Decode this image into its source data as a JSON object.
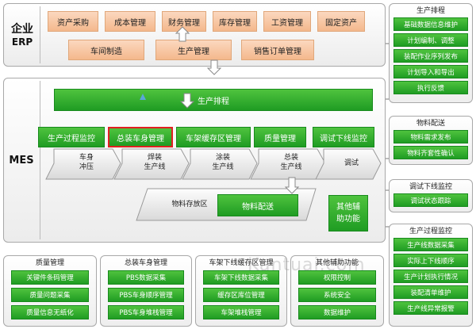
{
  "erp": {
    "label_top": "企业",
    "label_bottom": "ERP",
    "row1": [
      "资产采购",
      "成本管理",
      "财务管理",
      "库存管理",
      "工资管理",
      "固定资产"
    ],
    "row2": [
      "车间制造",
      "生产管理",
      "销售订单管理"
    ]
  },
  "mes": {
    "label": "MES",
    "top_bar": "生产排程",
    "modules": [
      "生产过程监控",
      "总装车身管理",
      "车架缓存区管理",
      "质量管理",
      "调试下线监控"
    ],
    "steps": [
      {
        "line1": "车身",
        "line2": "冲压"
      },
      {
        "line1": "焊装",
        "line2": "生产线"
      },
      {
        "line1": "涂装",
        "line2": "生产线"
      },
      {
        "line1": "总装",
        "line2": "生产线"
      },
      {
        "line1": "调试",
        "line2": ""
      }
    ],
    "storage_label": "物料存放区",
    "material_button": "物料配送",
    "other_line1": "其他辅",
    "other_line2": "助功能"
  },
  "right": [
    {
      "title": "生产排程",
      "items": [
        "基础数据信息维护",
        "计划编制、调整",
        "装配作业序列发布",
        "计划导入和导出",
        "执行反馈"
      ]
    },
    {
      "title": "物料配送",
      "items": [
        "物料需求发布",
        "物料齐套性确认"
      ]
    },
    {
      "title": "调试下线监控",
      "items": [
        "调试状态跟踪"
      ]
    },
    {
      "title": "生产过程监控",
      "items": [
        "生产线数据采集",
        "实际上下线顺序",
        "生产计划执行情况",
        "装配清单维护",
        "生产线异常报警"
      ]
    }
  ],
  "bottom": [
    {
      "title": "质量管理",
      "items": [
        "关键件条码管理",
        "质量问题采集",
        "质量信息无纸化"
      ]
    },
    {
      "title": "总装车身管理",
      "items": [
        "PBS数据采集",
        "PBS车身顺序管理",
        "PBS车身堆栈管理"
      ]
    },
    {
      "title": "车架下线缓存区管理",
      "items": [
        "车架下线数据采集",
        "缓存区库位管理",
        "车架堆栈管理"
      ]
    },
    {
      "title": "其他辅助功能",
      "items": [
        "权限控制",
        "系统安全",
        "数据维护"
      ]
    }
  ],
  "watermark": "Kantuai.com",
  "colors": {
    "green": "#2ea52c",
    "orange": "#f6c39e",
    "highlight": "#e02020"
  }
}
